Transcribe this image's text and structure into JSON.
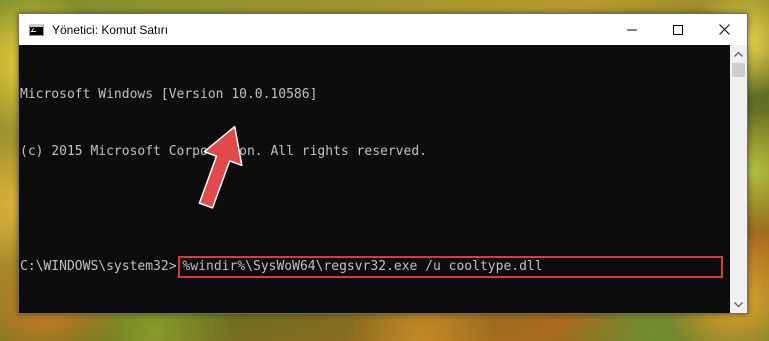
{
  "window": {
    "title": "Yönetici: Komut Satırı"
  },
  "console": {
    "lines": [
      "Microsoft Windows [Version 10.0.10586]",
      "(c) 2015 Microsoft Corporotion. All rights reserved.",
      ""
    ],
    "prompt": "C:\\WINDOWS\\system32>",
    "command": "%windir%\\SysWoW64\\regsvr32.exe /u cooltype.dll"
  },
  "icons": {
    "app": "cmd-icon",
    "minimize": "minimize-icon",
    "maximize": "maximize-icon",
    "close": "close-icon",
    "scroll_up": "chevron-up-icon",
    "scroll_down": "chevron-down-icon",
    "annotation": "red-arrow-icon"
  },
  "colors": {
    "highlight_border": "#d83b3b",
    "arrow": "#e24a4a",
    "console_bg": "#0c0c0c",
    "console_text": "#c0c0c0"
  }
}
